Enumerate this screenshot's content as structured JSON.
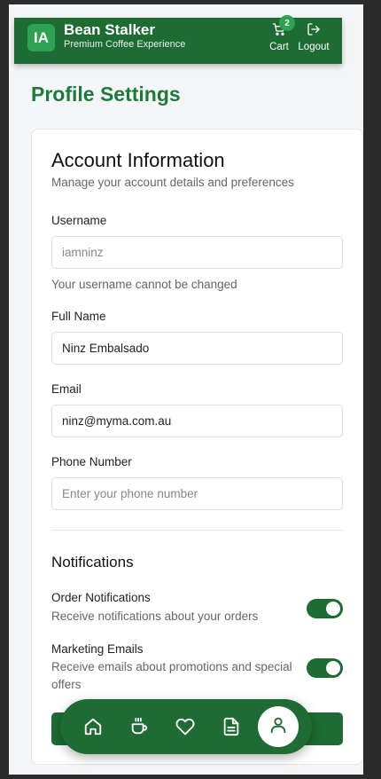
{
  "header": {
    "logo_initials": "IA",
    "brand_name": "Bean Stalker",
    "tagline": "Premium Coffee Experience",
    "cart_label": "Cart",
    "cart_count": "2",
    "logout_label": "Logout"
  },
  "page": {
    "title": "Profile Settings"
  },
  "account": {
    "title": "Account Information",
    "subtitle": "Manage your account details and preferences",
    "username": {
      "label": "Username",
      "value": "iamninz",
      "hint": "Your username cannot be changed"
    },
    "full_name": {
      "label": "Full Name",
      "value": "Ninz Embalsado"
    },
    "email": {
      "label": "Email",
      "value": "ninz@myma.com.au"
    },
    "phone": {
      "label": "Phone Number",
      "value": "",
      "placeholder": "Enter your phone number"
    }
  },
  "notifications": {
    "title": "Notifications",
    "items": [
      {
        "title": "Order Notifications",
        "description": "Receive notifications about your orders",
        "enabled": true
      },
      {
        "title": "Marketing Emails",
        "description": "Receive emails about promotions and special offers",
        "enabled": true
      }
    ]
  },
  "bottom_nav": {
    "items": [
      "home-icon",
      "coffee-icon",
      "heart-icon",
      "document-icon",
      "user-icon"
    ],
    "active": "user-icon"
  },
  "colors": {
    "brand_green": "#1e6b34",
    "accent_green": "#2ea152",
    "title_green": "#1e7a3a"
  }
}
